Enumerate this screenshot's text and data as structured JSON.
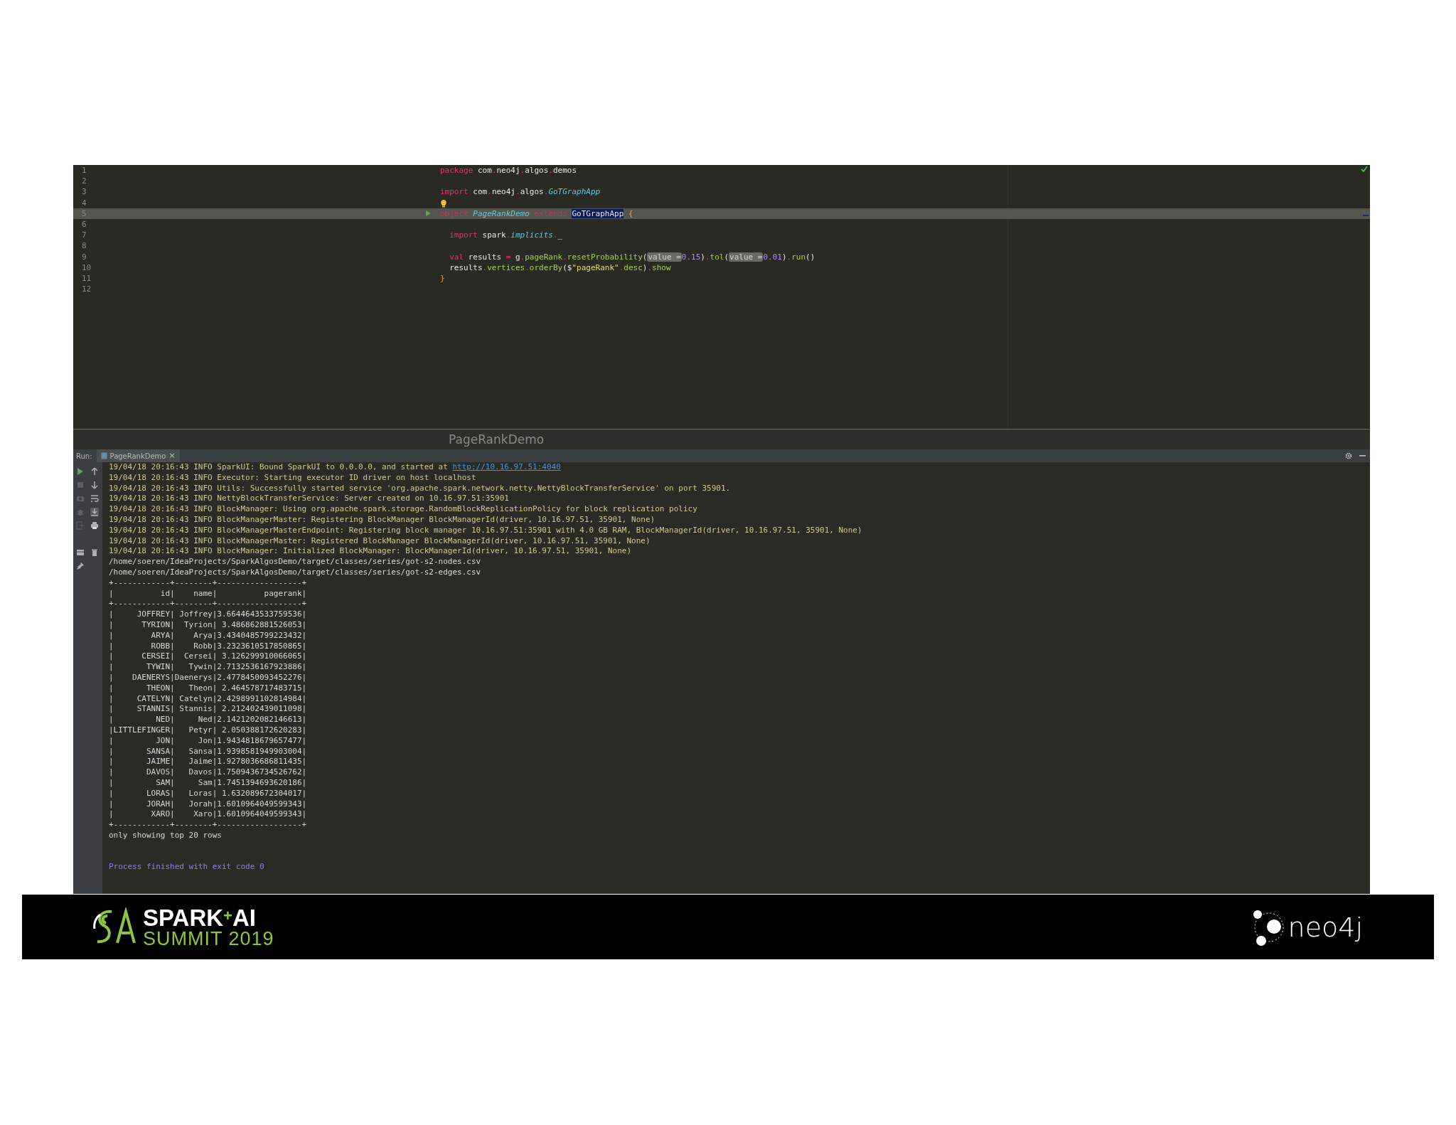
{
  "editor": {
    "lines": [
      {
        "number": "1",
        "tokens": [
          {
            "kind": "keyword",
            "text": "package"
          },
          {
            "kind": "plain",
            "text": " com"
          },
          {
            "kind": "punct",
            "text": "."
          },
          {
            "kind": "plain",
            "text": "neo4j"
          },
          {
            "kind": "punct",
            "text": "."
          },
          {
            "kind": "plain",
            "text": "algos"
          },
          {
            "kind": "punct",
            "text": "."
          },
          {
            "kind": "plain",
            "text": "demos"
          }
        ]
      },
      {
        "number": "2"
      },
      {
        "number": "3",
        "tokens": [
          {
            "kind": "keyword",
            "text": "import"
          },
          {
            "kind": "plain",
            "text": " com"
          },
          {
            "kind": "punct",
            "text": "."
          },
          {
            "kind": "plain",
            "text": "neo4j"
          },
          {
            "kind": "punct",
            "text": "."
          },
          {
            "kind": "plain",
            "text": "algos"
          },
          {
            "kind": "punct",
            "text": "."
          },
          {
            "kind": "type",
            "text": "GoTGraphApp"
          }
        ]
      },
      {
        "number": "4",
        "intention": true
      },
      {
        "number": "5",
        "current": true,
        "runnable": true,
        "tokens": [
          {
            "kind": "keyword",
            "text": "object "
          },
          {
            "kind": "type",
            "text": "PageRankDemo"
          },
          {
            "kind": "keyword",
            "text": " extends "
          },
          {
            "kind": "reference",
            "text": "GoTGraphApp"
          },
          {
            "kind": "brace",
            "text": " {"
          }
        ]
      },
      {
        "number": "6"
      },
      {
        "number": "7",
        "tokens": [
          {
            "kind": "keyword",
            "text": "  import"
          },
          {
            "kind": "plain",
            "text": " spark"
          },
          {
            "kind": "punct",
            "text": "."
          },
          {
            "kind": "type",
            "text": "implicits"
          },
          {
            "kind": "punct",
            "text": "."
          },
          {
            "kind": "plain",
            "text": "_"
          }
        ]
      },
      {
        "number": "8"
      },
      {
        "number": "9",
        "tokens": [
          {
            "kind": "keyword",
            "text": "  val"
          },
          {
            "kind": "plain",
            "text": " results "
          },
          {
            "kind": "punct",
            "text": "="
          },
          {
            "kind": "plain",
            "text": " g"
          },
          {
            "kind": "punct",
            "text": "."
          },
          {
            "kind": "method",
            "text": "pageRank"
          },
          {
            "kind": "punct",
            "text": "."
          },
          {
            "kind": "method",
            "text": "resetProbability"
          },
          {
            "kind": "plain",
            "text": "("
          },
          {
            "kind": "hint",
            "text": "value ="
          },
          {
            "kind": "number",
            "text": "0.15"
          },
          {
            "kind": "plain",
            "text": ")"
          },
          {
            "kind": "punct",
            "text": "."
          },
          {
            "kind": "method",
            "text": "tol"
          },
          {
            "kind": "plain",
            "text": "("
          },
          {
            "kind": "hint",
            "text": "value ="
          },
          {
            "kind": "number",
            "text": "0.01"
          },
          {
            "kind": "plain",
            "text": ")"
          },
          {
            "kind": "punct",
            "text": "."
          },
          {
            "kind": "method",
            "text": "run"
          },
          {
            "kind": "plain",
            "text": "()"
          }
        ]
      },
      {
        "number": "10",
        "tokens": [
          {
            "kind": "plain",
            "text": "  results"
          },
          {
            "kind": "punct",
            "text": "."
          },
          {
            "kind": "method",
            "text": "vertices"
          },
          {
            "kind": "punct",
            "text": "."
          },
          {
            "kind": "method",
            "text": "orderBy"
          },
          {
            "kind": "plain",
            "text": "($"
          },
          {
            "kind": "string",
            "text": "\"pageRank\""
          },
          {
            "kind": "punct",
            "text": "."
          },
          {
            "kind": "method",
            "text": "desc"
          },
          {
            "kind": "plain",
            "text": ")"
          },
          {
            "kind": "punct",
            "text": "."
          },
          {
            "kind": "method",
            "text": "show"
          }
        ]
      },
      {
        "number": "11",
        "tokens": [
          {
            "kind": "brace",
            "text": "}"
          }
        ]
      },
      {
        "number": "12"
      }
    ]
  },
  "ghost_title": "PageRankDemo",
  "run_panel": {
    "label": "Run:",
    "tab": {
      "title": "PageRankDemo",
      "close": "×",
      "selected": true
    },
    "toolbar_left": [
      {
        "kind": "run",
        "disabled": false
      },
      {
        "kind": "stop",
        "disabled": true
      },
      {
        "kind": "camera",
        "disabled": true
      },
      {
        "kind": "bug",
        "disabled": true
      },
      {
        "kind": "exit",
        "disabled": true
      },
      {
        "kind": "layout",
        "disabled": false
      },
      {
        "kind": "pin",
        "disabled": false
      }
    ],
    "toolbar_right": [
      {
        "kind": "up",
        "selected": false
      },
      {
        "kind": "down",
        "selected": false
      },
      {
        "kind": "wrap",
        "selected": false
      },
      {
        "kind": "scroll-end",
        "selected": true
      },
      {
        "kind": "print",
        "selected": false
      },
      {
        "kind": "trash",
        "selected": false
      }
    ],
    "console": [
      {
        "kind": "log",
        "text": "19/04/18 20:16:43 INFO SparkUI: Bound SparkUI to 0.0.0.0, and started at ",
        "link": "http://10.16.97.51:4040"
      },
      {
        "kind": "log",
        "text": "19/04/18 20:16:43 INFO Executor: Starting executor ID driver on host localhost"
      },
      {
        "kind": "log",
        "text": "19/04/18 20:16:43 INFO Utils: Successfully started service 'org.apache.spark.network.netty.NettyBlockTransferService' on port 35901."
      },
      {
        "kind": "log",
        "text": "19/04/18 20:16:43 INFO NettyBlockTransferService: Server created on 10.16.97.51:35901"
      },
      {
        "kind": "log",
        "text": "19/04/18 20:16:43 INFO BlockManager: Using org.apache.spark.storage.RandomBlockReplicationPolicy for block replication policy"
      },
      {
        "kind": "log",
        "text": "19/04/18 20:16:43 INFO BlockManagerMaster: Registering BlockManager BlockManagerId(driver, 10.16.97.51, 35901, None)"
      },
      {
        "kind": "log",
        "text": "19/04/18 20:16:43 INFO BlockManagerMasterEndpoint: Registering block manager 10.16.97.51:35901 with 4.0 GB RAM, BlockManagerId(driver, 10.16.97.51, 35901, None)"
      },
      {
        "kind": "log",
        "text": "19/04/18 20:16:43 INFO BlockManagerMaster: Registered BlockManager BlockManagerId(driver, 10.16.97.51, 35901, None)"
      },
      {
        "kind": "log",
        "text": "19/04/18 20:16:43 INFO BlockManager: Initialized BlockManager: BlockManagerId(driver, 10.16.97.51, 35901, None)"
      },
      {
        "kind": "output",
        "text": "/home/soeren/IdeaProjects/SparkAlgosDemo/target/classes/series/got-s2-nodes.csv"
      },
      {
        "kind": "output",
        "text": "/home/soeren/IdeaProjects/SparkAlgosDemo/target/classes/series/got-s2-edges.csv"
      },
      {
        "kind": "output",
        "text": "+------------+--------+------------------+"
      },
      {
        "kind": "output",
        "text": "|          id|    name|          pagerank|"
      },
      {
        "kind": "output",
        "text": "+------------+--------+------------------+"
      },
      {
        "kind": "output",
        "text": "|     JOFFREY| Joffrey|3.6644643533759536|"
      },
      {
        "kind": "output",
        "text": "|      TYRION|  Tyrion| 3.486862881526053|"
      },
      {
        "kind": "output",
        "text": "|        ARYA|    Arya|3.4340485799223432|"
      },
      {
        "kind": "output",
        "text": "|        ROBB|    Robb|3.2323610517850865|"
      },
      {
        "kind": "output",
        "text": "|      CERSEI|  Cersei| 3.126299910066065|"
      },
      {
        "kind": "output",
        "text": "|       TYWIN|   Tywin|2.7132536167923886|"
      },
      {
        "kind": "output",
        "text": "|    DAENERYS|Daenerys|2.4778450093452276|"
      },
      {
        "kind": "output",
        "text": "|       THEON|   Theon| 2.464578717483715|"
      },
      {
        "kind": "output",
        "text": "|     CATELYN| Catelyn|2.4298991102814984|"
      },
      {
        "kind": "output",
        "text": "|     STANNIS| Stannis| 2.212402439011098|"
      },
      {
        "kind": "output",
        "text": "|         NED|     Ned|2.1421202082146613|"
      },
      {
        "kind": "output",
        "text": "|LITTLEFINGER|   Petyr| 2.050388172620283|"
      },
      {
        "kind": "output",
        "text": "|         JON|     Jon|1.9434818679657477|"
      },
      {
        "kind": "output",
        "text": "|       SANSA|   Sansa|1.9398581949903004|"
      },
      {
        "kind": "output",
        "text": "|       JAIME|   Jaime|1.9278036686811435|"
      },
      {
        "kind": "output",
        "text": "|       DAVOS|   Davos|1.7509436734526762|"
      },
      {
        "kind": "output",
        "text": "|         SAM|     Sam|1.7451394693620186|"
      },
      {
        "kind": "output",
        "text": "|       LORAS|   Loras| 1.632089672304017|"
      },
      {
        "kind": "output",
        "text": "|       JORAH|   Jorah|1.6010964049599343|"
      },
      {
        "kind": "output",
        "text": "|        XARO|    Xaro|1.6010964049599343|"
      },
      {
        "kind": "output",
        "text": "+------------+--------+------------------+"
      },
      {
        "kind": "output",
        "text": "only showing top 20 rows"
      },
      {
        "kind": "exit",
        "text": "Process finished with exit code 0"
      }
    ]
  },
  "footer": {
    "event_logo": {
      "line1": "SPARK$^{+}$AI",
      "line2": "SUMMIT 2019"
    },
    "sponsor_logo": "neo4j"
  }
}
